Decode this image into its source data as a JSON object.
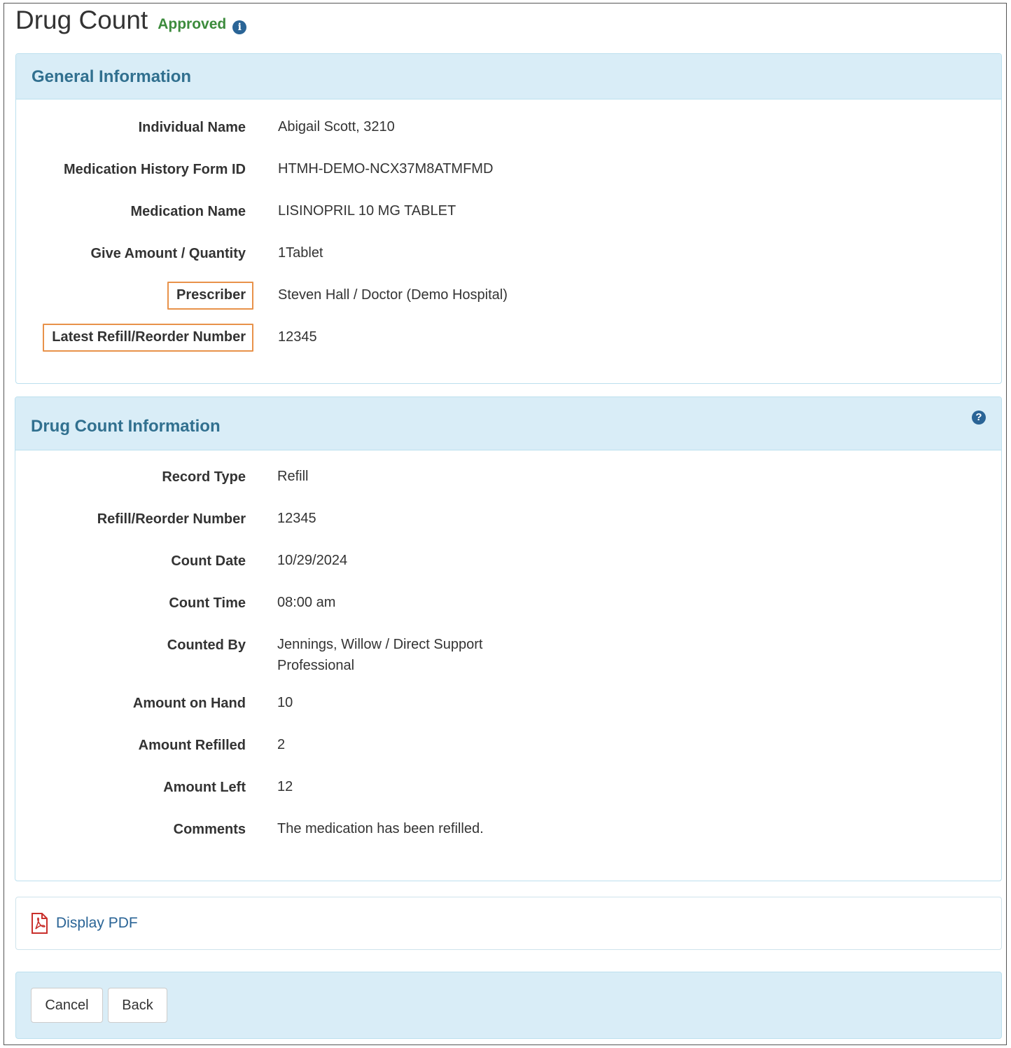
{
  "page": {
    "title": "Drug Count",
    "status": "Approved",
    "status_icon": "info-circle-icon"
  },
  "general": {
    "heading": "General Information",
    "fields": [
      {
        "label": "Individual Name",
        "value": "Abigail Scott, 3210"
      },
      {
        "label": "Medication History Form ID",
        "value": "HTMH-DEMO-NCX37M8ATMFMD"
      },
      {
        "label": "Medication Name",
        "value": "LISINOPRIL 10 MG TABLET"
      },
      {
        "label": "Give Amount / Quantity",
        "value": "1Tablet"
      },
      {
        "label": "Prescriber",
        "value": "Steven Hall / Doctor (Demo Hospital)",
        "highlighted": true
      },
      {
        "label": "Latest Refill/Reorder Number",
        "value": "12345",
        "highlighted": true
      }
    ]
  },
  "drug_count": {
    "heading": "Drug Count Information",
    "help_icon": "question-circle-icon",
    "fields": [
      {
        "label": "Record Type",
        "value": "Refill"
      },
      {
        "label": "Refill/Reorder Number",
        "value": "12345"
      },
      {
        "label": "Count Date",
        "value": "10/29/2024"
      },
      {
        "label": "Count Time",
        "value": "08:00 am"
      },
      {
        "label": "Counted By",
        "value": "Jennings, Willow / Direct Support",
        "value_line2": "Professional"
      },
      {
        "label": "Amount on Hand",
        "value": "10"
      },
      {
        "label": "Amount Refilled",
        "value": "2"
      },
      {
        "label": "Amount Left",
        "value": "12"
      },
      {
        "label": "Comments",
        "value": "The medication has been refilled."
      }
    ]
  },
  "pdf": {
    "label": "Display PDF",
    "icon": "pdf-file-icon"
  },
  "actions": {
    "cancel_label": "Cancel",
    "back_label": "Back"
  },
  "colors": {
    "status_green": "#3c8b3c",
    "heading_blue": "#31708f",
    "panel_bg": "#d9edf7",
    "highlight_border": "#e8924a",
    "link_blue": "#2a6496"
  }
}
